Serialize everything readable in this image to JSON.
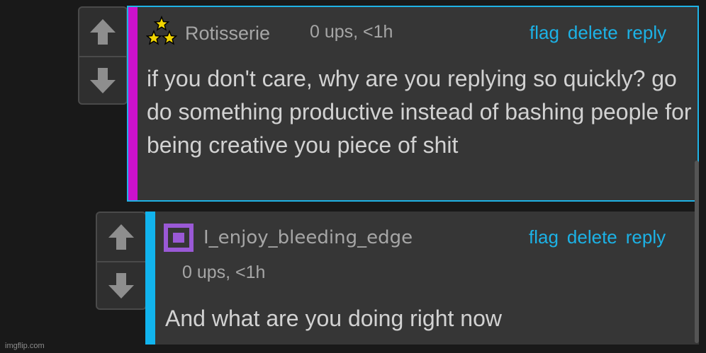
{
  "comments": [
    {
      "username": "Rotisserie",
      "avatar_icon": "three-stars-icon",
      "meta": "0 ups, <1h",
      "actions": [
        "flag",
        "delete",
        "reply"
      ],
      "text": "if you don't care, why are you replying so quickly? go do something productive instead of bashing people for being creative you piece of shit",
      "stripe_color": "#cc11cc",
      "border_color": "#1fb3e6"
    },
    {
      "username": "I_enjoy_bleeding_edge",
      "avatar_icon": "purple-square-icon",
      "meta": "0 ups, <1h",
      "actions": [
        "flag",
        "delete",
        "reply"
      ],
      "text": "And what are you doing right now",
      "stripe_color": "#11b4ee"
    }
  ],
  "vote_icons": {
    "up": "up-arrow-icon",
    "down": "down-arrow-icon"
  },
  "watermark": "imgflip.com",
  "colors": {
    "background": "#191919",
    "panel": "#363636",
    "link": "#1cb2e6",
    "text": "#d2d2d2"
  }
}
